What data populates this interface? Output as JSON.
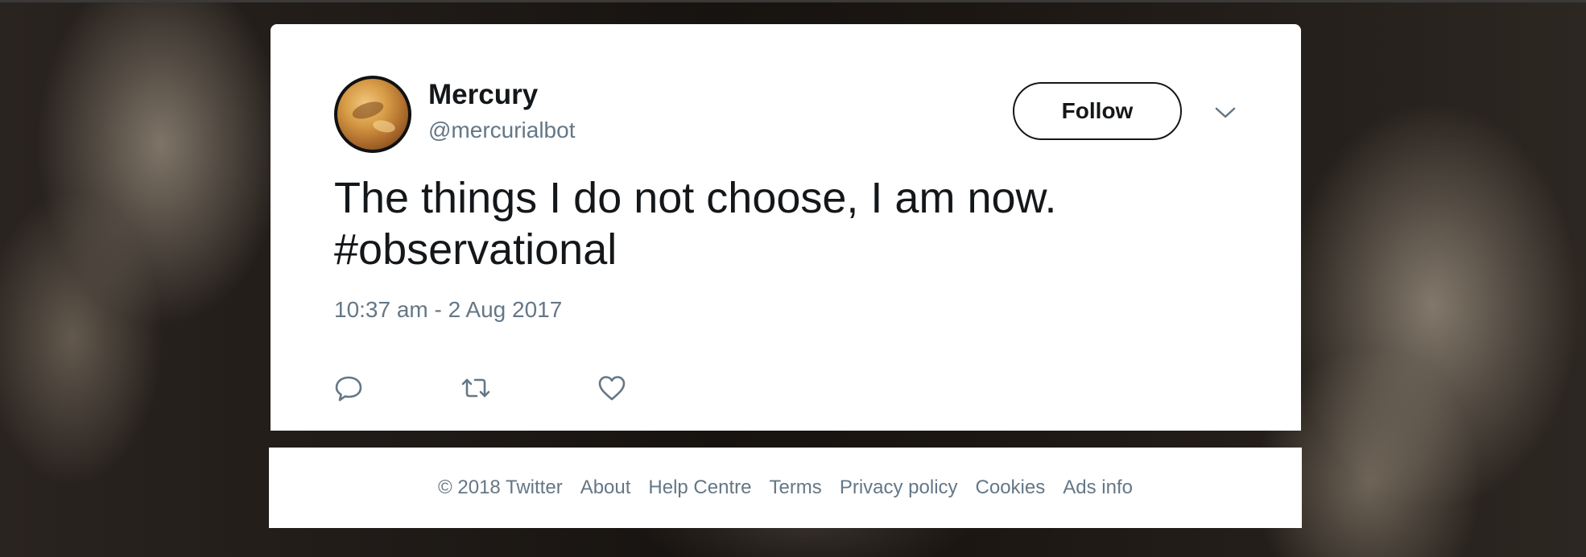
{
  "tweet": {
    "display_name": "Mercury",
    "handle": "@mercurialbot",
    "follow_label": "Follow",
    "text_lines": [
      "The things I do not choose, I am now.",
      "#observational"
    ],
    "timestamp": "10:37 am - 2 Aug 2017",
    "actions": [
      "reply-icon",
      "retweet-icon",
      "like-icon"
    ],
    "avatar_icon": "planet-avatar"
  },
  "footer": {
    "copyright": "© 2018 Twitter",
    "links": [
      "About",
      "Help Centre",
      "Terms",
      "Privacy policy",
      "Cookies",
      "Ads info"
    ]
  },
  "colors": {
    "text_primary": "#14171a",
    "text_secondary": "#657786",
    "card_background": "#ffffff"
  }
}
